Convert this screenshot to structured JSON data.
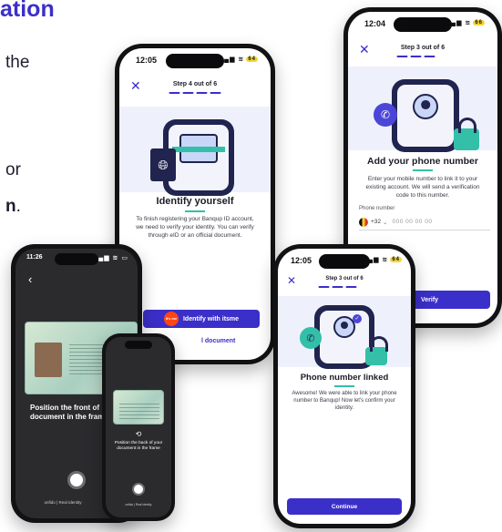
{
  "page": {
    "title_fragment": "ation",
    "line_fragment_1": "the",
    "line_fragment_2": "or",
    "line_fragment_3": "n",
    "line_fragment_3_punct": "."
  },
  "colors": {
    "brand": "#3b2fc9",
    "accent": "#33bfa8",
    "hero_bg": "#eef0fb",
    "dark_screen": "#2b2b2e"
  },
  "phone_identify": {
    "time": "12:05",
    "battery": "64",
    "step": "Step 4 out of 6",
    "title": "Identify yourself",
    "body": "To finish registering your Banqup ID account, we need to verify your identity. You can verify through eID or an official document.",
    "primary_button": "Identify with itsme",
    "secondary_link": "l document",
    "itsme_badge": "it's me"
  },
  "phone_add_phone": {
    "time": "12:04",
    "battery": "66",
    "step": "Step 3 out of 6",
    "title": "Add your phone number",
    "body": "Enter your mobile number to link it to your existing account. We will send a verification code to this number.",
    "field_label": "Phone number",
    "country_code": "+32",
    "phone_placeholder": "000 00 00 00",
    "verify_button": "Verify"
  },
  "phone_linked": {
    "time": "12:05",
    "battery": "64",
    "step": "Step 3 out of 6",
    "title": "Phone number linked",
    "body": "Awesome! We were able to link your phone number to Banqup! Now let's confirm your identity.",
    "continue_button": "Continue"
  },
  "phone_scan_front": {
    "time": "11:26",
    "instruction": "Position the front of document in the fram",
    "powered_by": "onfido | Real Identity"
  },
  "phone_scan_back": {
    "instruction": "Position the back of your document in the frame",
    "powered_by": "onfido | Real Identity"
  }
}
